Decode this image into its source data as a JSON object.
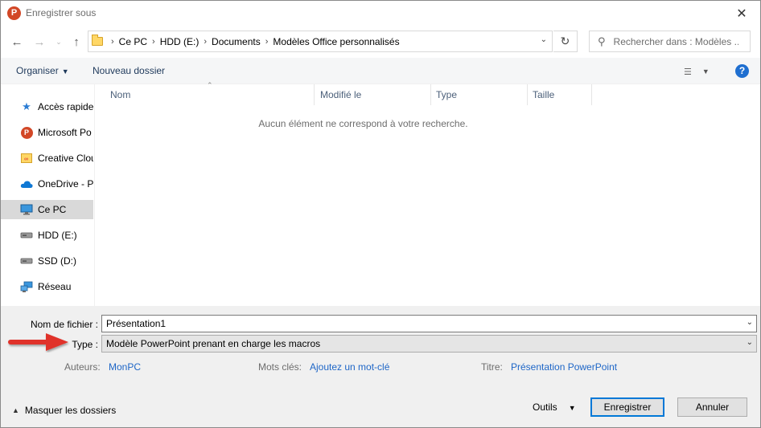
{
  "window": {
    "title": "Enregistrer sous",
    "app_icon_letter": "P",
    "close_glyph": "✕"
  },
  "nav": {
    "breadcrumbs": [
      "Ce PC",
      "HDD (E:)",
      "Documents",
      "Modèles Office personnalisés"
    ],
    "search_placeholder": "Rechercher dans : Modèles ..."
  },
  "toolbar": {
    "organise_label": "Organiser",
    "new_folder_label": "Nouveau dossier",
    "help_glyph": "?"
  },
  "sidebar": {
    "items": [
      {
        "label": "Accès rapide",
        "icon": "star-icon"
      },
      {
        "label": "Microsoft Po",
        "icon": "powerpoint-icon"
      },
      {
        "label": "Creative Clou",
        "icon": "creative-cloud-folder-icon"
      },
      {
        "label": "OneDrive - P",
        "icon": "onedrive-icon"
      },
      {
        "label": "Ce PC",
        "icon": "computer-icon",
        "selected": true
      },
      {
        "label": "HDD (E:)",
        "icon": "drive-icon"
      },
      {
        "label": "SSD (D:)",
        "icon": "drive-icon"
      },
      {
        "label": "Réseau",
        "icon": "network-icon"
      }
    ]
  },
  "list": {
    "columns": [
      "Nom",
      "Modifié le",
      "Type",
      "Taille"
    ],
    "empty_message": "Aucun élément ne correspond à votre recherche."
  },
  "form": {
    "filename_label": "Nom de fichier :",
    "filename_value": "Présentation1",
    "type_label": "Type :",
    "type_value": "Modèle PowerPoint prenant en charge les macros",
    "authors_label": "Auteurs:",
    "authors_value": "MonPC",
    "keywords_label": "Mots clés:",
    "keywords_value": "Ajoutez un mot-clé",
    "title_label": "Titre:",
    "title_value": "Présentation PowerPoint"
  },
  "footer": {
    "hide_folders_label": "Masquer les dossiers",
    "tools_label": "Outils",
    "save_label": "Enregistrer",
    "cancel_label": "Annuler"
  },
  "colors": {
    "accent": "#0078d7",
    "link": "#1e66c7",
    "arrow": "#e0322b",
    "powerpoint": "#d24726"
  }
}
